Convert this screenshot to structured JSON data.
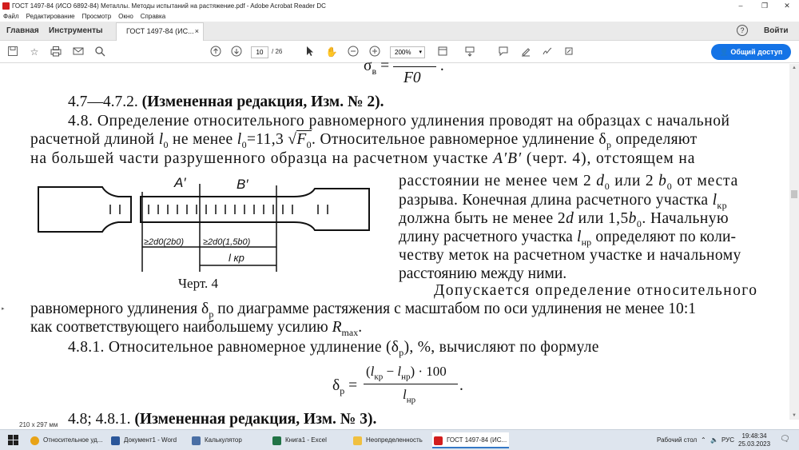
{
  "window": {
    "title": "ГОСТ 1497-84 (ИСО 6892-84) Металлы. Методы испытаний на растяжение.pdf - Adobe Acrobat Reader DC",
    "controls": {
      "minimize": "–",
      "restore": "❐",
      "close": "✕"
    }
  },
  "menu": [
    "Файл",
    "Редактирование",
    "Просмотр",
    "Окно",
    "Справка"
  ],
  "tabs": {
    "home": "Главная",
    "tools": "Инструменты",
    "document": "ГОСТ 1497-84 (ИС...",
    "close": "×"
  },
  "header": {
    "help": "?",
    "signin": "Войти"
  },
  "toolbar": {
    "page_current": "10",
    "page_total": "/ 26",
    "zoom": "200%",
    "zoom_caret": "▾",
    "share_label": "Общий доступ"
  },
  "page": {
    "top_formula": "σв = ────── .",
    "top_formula_den": "F0",
    "p1": "4.7—4.7.2. (Измененная редакция, Изм. № 2).",
    "p2a": "4.8. Определение относительного равномерного удлинения проводят на образцах с начальной",
    "p2b": "расчетной длиной l0 не менее l0=11,3 √F0. Относительное равномерное удлинение δp определяют",
    "p2c": "на большей части разрушенного образца на расчетном участке A′B′ (черт. 4), отстоящем на",
    "r1": "расстоянии не менее чем 2 d0 или 2 b0 от места",
    "r2": "разрыва. Конечная длина расчетного участка lкр",
    "r3": "должна быть не менее 2d или 1,5b0. Начальную",
    "r4": "длину расчетного участка lнр определяют по коли-",
    "r5": "честву меток на расчетном участке и начальному",
    "r6": "расстоянию между ними.",
    "r7": "Допускается определение относительного",
    "p3a": "равномерного удлинения δp по диаграмме растяжения с масштабом по оси удлинения не менее 10:1",
    "p3b": "как соответствующего наибольшему усилию Rmax.",
    "p4": "4.8.1. Относительное равномерное удлинение (δp), %, вычисляют по формуле",
    "formula_lhs": "δp =",
    "formula_num": "(lкр − lнр) · 100",
    "formula_den": "lнр",
    "formula_end": ".",
    "bottom_cut": "4.8; 4.8.1. (Измененная редакция, Изм. № 3).",
    "figure": {
      "caption": "Черт. 4",
      "label_a": "A′",
      "label_b": "B′",
      "dim1": "≥2d0(2b0)",
      "dim2": "≥2d0(1,5b0)",
      "dim3": "l кр"
    }
  },
  "status": {
    "page_size": "210 x 297 мм"
  },
  "taskbar": {
    "items": [
      {
        "label": "Относительное уд...",
        "color": "#e8a317"
      },
      {
        "label": "Документ1 - Word",
        "color": "#2b579a"
      },
      {
        "label": "Калькулятор",
        "color": "#4a6fa5"
      },
      {
        "label": "Книга1 - Excel",
        "color": "#217346"
      },
      {
        "label": "Неопределенность",
        "color": "#f0c040"
      },
      {
        "label": "ГОСТ 1497-84 (ИС...",
        "color": "#d21d1d"
      }
    ],
    "desktop": "Рабочий стол",
    "lang": "РУС",
    "time": "19:48:34",
    "date": "25.03.2023"
  }
}
